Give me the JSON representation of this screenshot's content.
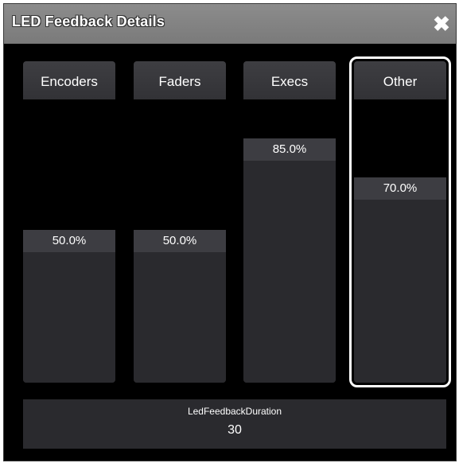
{
  "dialog": {
    "title": "LED Feedback Details",
    "close_icon": "close-icon"
  },
  "faders": [
    {
      "label": "Encoders",
      "value_text": "50.0%",
      "level": 0.5,
      "selected": false
    },
    {
      "label": "Faders",
      "value_text": "50.0%",
      "level": 0.5,
      "selected": false
    },
    {
      "label": "Execs",
      "value_text": "85.0%",
      "level": 0.85,
      "selected": false
    },
    {
      "label": "Other",
      "value_text": "70.0%",
      "level": 0.7,
      "selected": true
    }
  ],
  "duration": {
    "label": "LedFeedbackDuration",
    "value": "30"
  },
  "colors": {
    "background": "#000000",
    "titlebar": "#808080",
    "fader_fill": "#2a2a2e",
    "value_bar": "#3d3d42",
    "selection": "#ffffff"
  }
}
